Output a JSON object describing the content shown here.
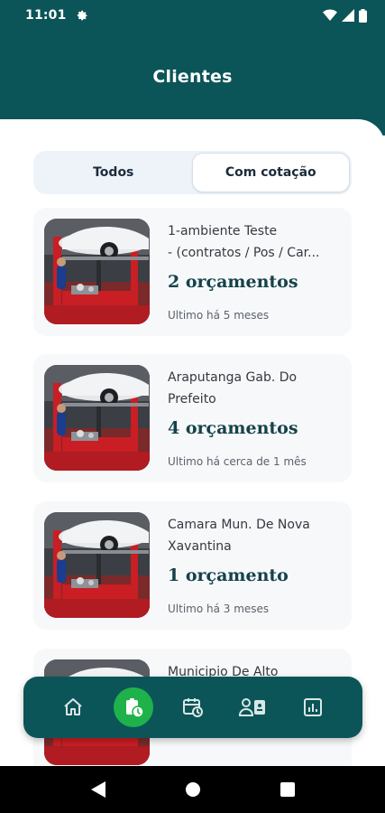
{
  "status_bar": {
    "time": "11:01"
  },
  "header": {
    "title": "Clientes"
  },
  "tabs": [
    {
      "label": "Todos",
      "active": false
    },
    {
      "label": "Com cotação",
      "active": true
    }
  ],
  "clients": [
    {
      "title_line1": "1-ambiente Teste",
      "title_line2": "- (contratos / Pos / Car...",
      "count": "2 orçamentos",
      "last": "Ultimo há 5 meses"
    },
    {
      "title_line1": "Araputanga Gab. Do",
      "title_line2": "Prefeito",
      "count": "4 orçamentos",
      "last": "Ultimo há cerca de 1 mês"
    },
    {
      "title_line1": "Camara Mun. De Nova",
      "title_line2": "Xavantina",
      "count": "1 orçamento",
      "last": "Ultimo há 3 meses"
    },
    {
      "title_line1": "Municipio De Alto",
      "title_line2": "",
      "count": "",
      "last": ""
    }
  ],
  "bottom_nav": [
    {
      "icon": "home-icon",
      "active": false
    },
    {
      "icon": "clipboard-clock-icon",
      "active": true
    },
    {
      "icon": "calendar-clock-icon",
      "active": false
    },
    {
      "icon": "person-card-icon",
      "active": false
    },
    {
      "icon": "chart-icon",
      "active": false
    }
  ],
  "colors": {
    "primary": "#0b5558",
    "accent": "#1fb24a",
    "card_bg": "#f7f8fa"
  }
}
